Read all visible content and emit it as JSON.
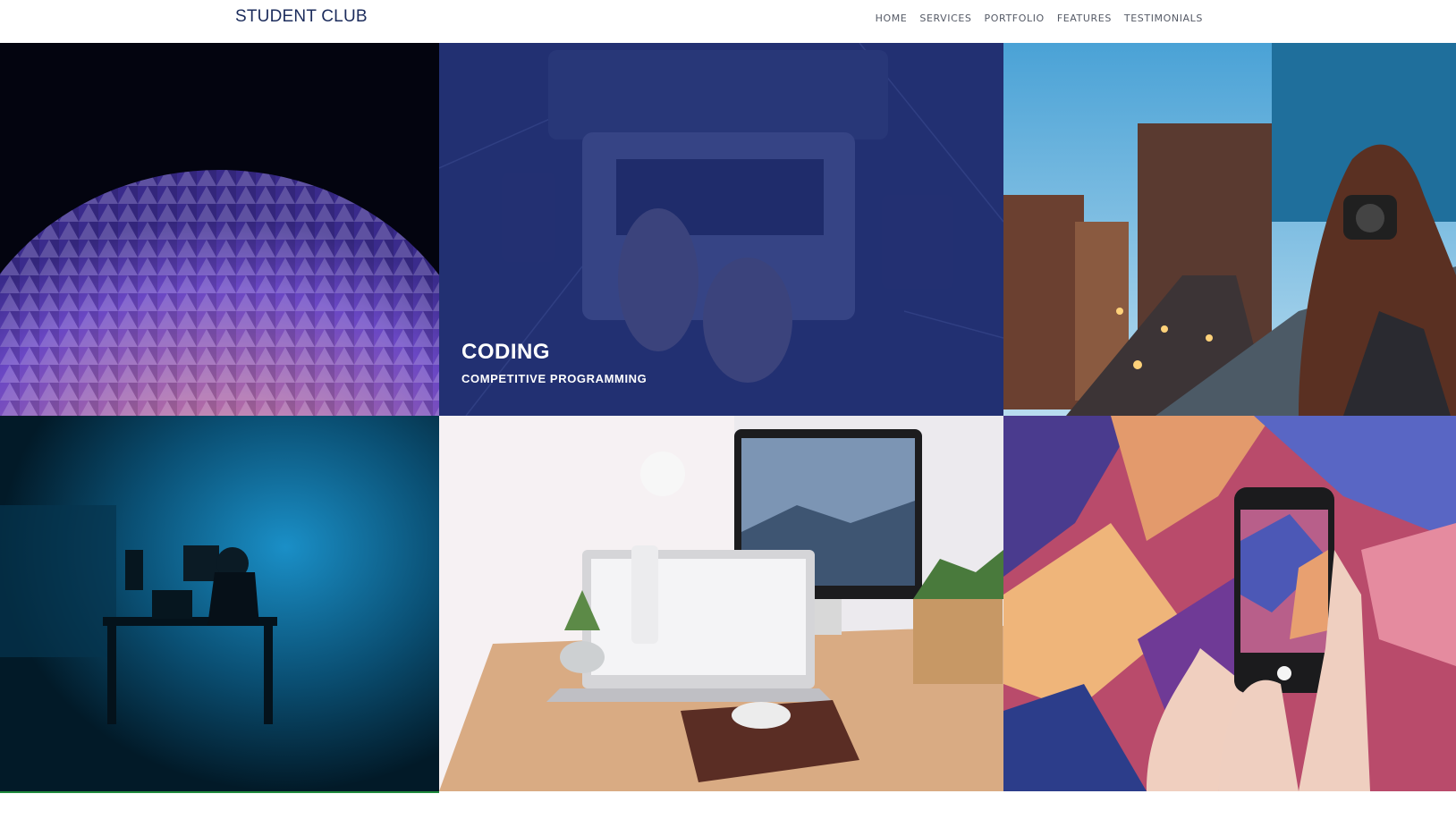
{
  "brand": "STUDENT CLUB",
  "nav": {
    "home": "HOME",
    "services": "SERVICES",
    "portfolio": "PORTFOLIO",
    "features": "FEATURES",
    "testimonials": "TESTIMONIALS"
  },
  "portfolio": {
    "featured": {
      "title": "CODING",
      "subtitle": "COMPETITIVE PROGRAMMING"
    }
  },
  "colors": {
    "brand": "#1c2c5c",
    "overlay": "#1d2a6c",
    "accent_line": "#1f8a3c"
  }
}
